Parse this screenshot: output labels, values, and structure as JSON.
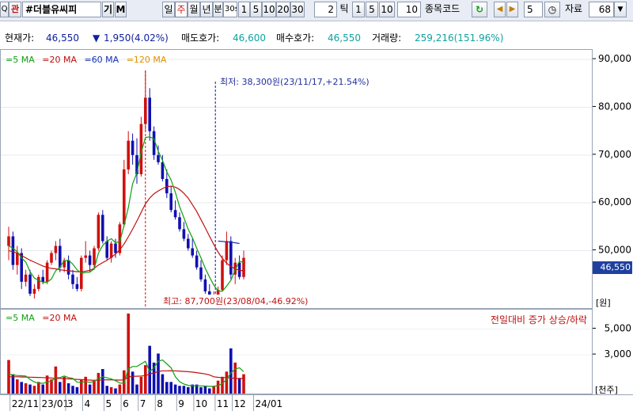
{
  "toolbar": {
    "search_glyph": "Q",
    "search_tag": "관",
    "stock_name": "#더블유씨피",
    "tab_gi": "기",
    "tab_m": "M",
    "period_buttons": [
      "일",
      "주",
      "월",
      "년",
      "분",
      "30",
      "1",
      "5",
      "10",
      "20",
      "30"
    ],
    "period_active": "주",
    "minute_value": "30s",
    "tick_count": "2",
    "tick_label": "틱",
    "tick_buttons": [
      "1",
      "5",
      "10"
    ],
    "tick_value": "10",
    "code_label": "종목코드",
    "count_value": "5",
    "data_label": "자료",
    "data_count": "68"
  },
  "info": {
    "price_label": "현재가:",
    "price_value": "46,550",
    "change_arrow": "▼",
    "change_value": "1,950(4.02%)",
    "ask_label": "매도호가:",
    "ask_value": "46,600",
    "bid_label": "매수호가:",
    "bid_value": "46,550",
    "volume_label": "거래량:",
    "volume_value": "259,216(151.96%)"
  },
  "colors": {
    "up": "#d01010",
    "down": "#1010b0",
    "ma5": "#10a010",
    "ma20": "#c01010",
    "ma60": "#1030b0",
    "ma120": "#e09000",
    "price_box": "#2040a0"
  },
  "price_panel": {
    "legend": [
      {
        "name": "5 MA",
        "color": "#10a010"
      },
      {
        "name": "20 MA",
        "color": "#c01010"
      },
      {
        "name": "60 MA",
        "color": "#1030b0"
      },
      {
        "name": "120 MA",
        "color": "#e09000"
      }
    ],
    "unit": "[원]",
    "current_price": "46,550",
    "annotation_low": "최저: 38,300원(23/11/17,+21.54%)",
    "annotation_high": "최고: 87,700원(23/08/04,-46.92%)"
  },
  "volume_panel": {
    "legend": [
      {
        "name": "5 MA",
        "color": "#10a010"
      },
      {
        "name": "20 MA",
        "color": "#c01010"
      }
    ],
    "note": "전일대비 증가 상승/하락",
    "unit": "[천주]"
  },
  "chart_data": [
    {
      "type": "candlestick",
      "title": "",
      "ylim": [
        38000,
        92000
      ],
      "ticks": [
        "90,000",
        "80,000",
        "70,000",
        "60,000",
        "50,000"
      ],
      "tick_values": [
        90000,
        80000,
        70000,
        60000,
        50000
      ],
      "x_labels": [
        "22/11",
        "23/01",
        "3",
        "4",
        "5",
        "6",
        "7",
        "8",
        "9",
        "10",
        "11",
        "12",
        "24/01"
      ],
      "x_label_index": [
        1,
        8,
        14,
        18,
        23,
        27,
        31,
        35,
        40,
        44,
        49,
        53,
        58
      ],
      "ohlc": [
        [
          51000,
          55000,
          48000,
          53000
        ],
        [
          53000,
          54000,
          46000,
          47000
        ],
        [
          47000,
          51000,
          45000,
          49500
        ],
        [
          49500,
          50500,
          42000,
          43500
        ],
        [
          43500,
          46000,
          42500,
          45000
        ],
        [
          45000,
          46000,
          40500,
          41000
        ],
        [
          41000,
          43000,
          40000,
          42000
        ],
        [
          42000,
          45000,
          41500,
          44500
        ],
        [
          44500,
          46000,
          43000,
          43500
        ],
        [
          43500,
          48000,
          43000,
          47500
        ],
        [
          47500,
          50000,
          47000,
          49500
        ],
        [
          49500,
          52000,
          48000,
          51000
        ],
        [
          51000,
          52500,
          45500,
          46500
        ],
        [
          46500,
          48500,
          45500,
          48000
        ],
        [
          48000,
          49000,
          44000,
          45000
        ],
        [
          45000,
          46000,
          42000,
          43000
        ],
        [
          43000,
          44500,
          41500,
          42000
        ],
        [
          42000,
          49000,
          41500,
          48500
        ],
        [
          48500,
          52000,
          47500,
          49000
        ],
        [
          49000,
          50000,
          45500,
          47000
        ],
        [
          47000,
          51000,
          46000,
          50500
        ],
        [
          50500,
          58000,
          50000,
          57500
        ],
        [
          57500,
          58500,
          51500,
          52000
        ],
        [
          52000,
          53000,
          48000,
          48500
        ],
        [
          48500,
          52000,
          47500,
          51500
        ],
        [
          51500,
          52500,
          48500,
          49500
        ],
        [
          49500,
          56000,
          49000,
          55500
        ],
        [
          55500,
          69000,
          55000,
          67000
        ],
        [
          67000,
          75000,
          66000,
          73000
        ],
        [
          73000,
          74500,
          68000,
          70000
        ],
        [
          70000,
          73500,
          64000,
          66000
        ],
        [
          66000,
          78000,
          65500,
          76500
        ],
        [
          76500,
          87700,
          75000,
          82000
        ],
        [
          82000,
          84000,
          73000,
          75000
        ],
        [
          75000,
          76000,
          69000,
          70000
        ],
        [
          70000,
          72000,
          68000,
          68500
        ],
        [
          68500,
          70000,
          64500,
          65000
        ],
        [
          65000,
          67000,
          61000,
          62000
        ],
        [
          62000,
          63500,
          58000,
          58500
        ],
        [
          58500,
          60500,
          56500,
          57000
        ],
        [
          57000,
          58000,
          54000,
          54500
        ],
        [
          54500,
          56000,
          52000,
          52500
        ],
        [
          52500,
          53500,
          50000,
          50500
        ],
        [
          50500,
          52500,
          48500,
          49000
        ],
        [
          49000,
          50000,
          46000,
          46500
        ],
        [
          46500,
          48000,
          43500,
          44000
        ],
        [
          44000,
          45000,
          41000,
          41500
        ],
        [
          41500,
          43000,
          39000,
          40000
        ],
        [
          40000,
          41500,
          38300,
          40500
        ],
        [
          40500,
          42500,
          39500,
          41800
        ],
        [
          41800,
          49000,
          41500,
          48000
        ],
        [
          48000,
          54000,
          47000,
          52000
        ],
        [
          52000,
          53000,
          44000,
          45000
        ],
        [
          45000,
          48500,
          43000,
          47500
        ],
        [
          47500,
          49000,
          44000,
          44500
        ],
        [
          44500,
          50000,
          44000,
          48500
        ]
      ],
      "ma5": [
        51000,
        50500,
        49800,
        48500,
        47600,
        45600,
        44300,
        43800,
        43400,
        43400,
        44100,
        45800,
        46600,
        47900,
        48000,
        47200,
        46000,
        45300,
        45400,
        45500,
        46200,
        49500,
        51100,
        52000,
        52500,
        51700,
        51900,
        55300,
        59000,
        64000,
        66300,
        70500,
        73700,
        73800,
        73400,
        70800,
        68900,
        66500,
        64800,
        62200,
        59200,
        56900,
        54500,
        52700,
        50500,
        48500,
        46300,
        44500,
        42800,
        41600,
        41500,
        42600,
        43800,
        46000,
        47800,
        47500
      ],
      "ma20": [
        50000,
        49800,
        49500,
        49000,
        48500,
        48000,
        47600,
        47200,
        46800,
        46500,
        46300,
        46200,
        46000,
        45900,
        45800,
        45700,
        45600,
        45600,
        45700,
        45900,
        46300,
        47000,
        47500,
        48000,
        48600,
        49300,
        50200,
        51400,
        52900,
        54500,
        56200,
        58000,
        59800,
        61000,
        61900,
        62500,
        63000,
        63400,
        63500,
        63300,
        62800,
        62000,
        61000,
        59600,
        58200,
        56500,
        54800,
        53000,
        51300,
        49700,
        48400,
        47400,
        46700,
        46200,
        45900,
        45800
      ],
      "ma60_segment": [
        [
          49,
          52000
        ],
        [
          52,
          51800
        ],
        [
          54,
          51500
        ]
      ]
    },
    {
      "type": "bar",
      "title": "",
      "ylim": [
        0,
        6500
      ],
      "ticks": [
        "5,000",
        "3,000"
      ],
      "tick_values": [
        5000,
        3000
      ],
      "volumes": [
        2600,
        1500,
        1100,
        900,
        800,
        700,
        600,
        900,
        700,
        1400,
        1100,
        2100,
        900,
        1300,
        800,
        600,
        500,
        1100,
        1300,
        700,
        1000,
        1600,
        1900,
        600,
        500,
        400,
        700,
        1800,
        6200,
        1700,
        700,
        1300,
        2200,
        3700,
        2400,
        3100,
        1500,
        900,
        900,
        700,
        600,
        600,
        500,
        700,
        700,
        500,
        600,
        400,
        600,
        1000,
        1300,
        1700,
        3500,
        2400,
        1200,
        1500
      ],
      "vol_ma5": [
        1500,
        1450,
        1400,
        1380,
        1360,
        1100,
        900,
        800,
        800,
        880,
        960,
        1240,
        1240,
        1360,
        1240,
        1180,
        880,
        860,
        940,
        860,
        960,
        1140,
        1300,
        1220,
        1140,
        1000,
        820,
        800,
        1920,
        2100,
        2100,
        2300,
        2500,
        1700,
        2000,
        2500,
        2600,
        2300,
        2000,
        1300,
        920,
        740,
        640,
        600,
        600,
        600,
        580,
        560,
        560,
        620,
        780,
        1100,
        1600,
        1900,
        2000,
        1700
      ],
      "vol_ma20": [
        1300,
        1300,
        1300,
        1290,
        1280,
        1270,
        1260,
        1250,
        1240,
        1220,
        1200,
        1180,
        1170,
        1160,
        1140,
        1120,
        1100,
        1080,
        1060,
        1040,
        1030,
        1040,
        1060,
        1070,
        1060,
        1050,
        1040,
        1060,
        1290,
        1340,
        1340,
        1360,
        1390,
        1520,
        1600,
        1720,
        1760,
        1760,
        1770,
        1760,
        1740,
        1720,
        1690,
        1660,
        1620,
        1570,
        1520,
        1450,
        1300,
        1260,
        1240,
        1240,
        1200,
        1180,
        1170,
        1170
      ]
    }
  ]
}
